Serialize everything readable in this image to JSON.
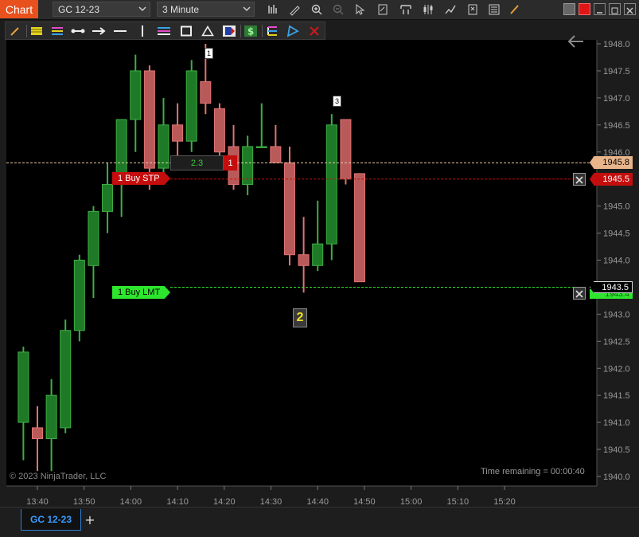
{
  "window": {
    "title": "Chart"
  },
  "toolbar": {
    "instrument": "GC 12-23",
    "interval": "3 Minute"
  },
  "icons": {
    "top": [
      "bar-chart-icon",
      "pencil-icon",
      "zoom-in-icon",
      "zoom-out-icon",
      "pointer-icon",
      "edit-doc-icon",
      "brackets-icon",
      "candlestick-icon",
      "line-chart-icon",
      "strategy-icon",
      "properties-icon",
      "draw-tool-icon"
    ],
    "draw": [
      "pencil-icon",
      "fib-icon",
      "layers-icon",
      "segment-icon",
      "arrow-line-icon",
      "horizontal-line-icon",
      "vertical-line-icon",
      "channel-icon",
      "rectangle-icon",
      "triangle-icon",
      "region-icon",
      "dollar-icon",
      "fib-ext-icon",
      "ruler-icon",
      "delete-draw-icon"
    ]
  },
  "chart": {
    "copyright": "© 2023 NinjaTrader, LLC",
    "time_remaining": "Time remaining = 00:00:40",
    "current_price_label": "1945.8",
    "buy_stp_price_label": "1945.5",
    "buy_lmt_price_label": "1943.5",
    "buy_lmt_under_label": "1943.4",
    "buy_stp_label": "1  Buy STP",
    "buy_lmt_label": "1  Buy LMT",
    "position_value": "2.3",
    "position_qty": "1",
    "marker_1": "1",
    "marker_2": "2",
    "marker_3": "3",
    "colors": {
      "up": "#1f7a28",
      "up_border": "#3fae45",
      "down": "#b85a5a",
      "down_border": "#e07474",
      "buy_stp": "#c40e0e",
      "buy_lmt": "#2ee62e",
      "current": "#e8b48a"
    }
  },
  "chart_data": {
    "type": "candlestick",
    "y_ticks": [
      "1948.0",
      "1947.5",
      "1947.0",
      "1946.5",
      "1946.0",
      "1945.5",
      "1945.0",
      "1944.5",
      "1944.0",
      "1943.5",
      "1943.0",
      "1942.5",
      "1942.0",
      "1941.5",
      "1941.0",
      "1940.5",
      "1940.0"
    ],
    "ylim": [
      1939.93,
      1948.1
    ],
    "x_ticks": [
      "13:40",
      "13:50",
      "14:00",
      "14:10",
      "14:20",
      "14:30",
      "14:40",
      "14:50",
      "15:00",
      "15:10",
      "15:20"
    ],
    "x_tick_minutes": [
      820,
      830,
      840,
      850,
      860,
      870,
      880,
      890,
      900,
      910,
      920
    ],
    "candles": [
      {
        "t": 817,
        "o": 1941.0,
        "h": 1942.4,
        "l": 1940.3,
        "c": 1942.3
      },
      {
        "t": 820,
        "o": 1940.9,
        "h": 1941.3,
        "l": 1940.1,
        "c": 1940.7
      },
      {
        "t": 823,
        "o": 1940.7,
        "h": 1941.8,
        "l": 1940.1,
        "c": 1941.5
      },
      {
        "t": 826,
        "o": 1940.9,
        "h": 1942.9,
        "l": 1940.8,
        "c": 1942.7
      },
      {
        "t": 829,
        "o": 1942.7,
        "h": 1944.1,
        "l": 1942.5,
        "c": 1944.0
      },
      {
        "t": 832,
        "o": 1943.9,
        "h": 1945.0,
        "l": 1943.3,
        "c": 1944.9
      },
      {
        "t": 835,
        "o": 1944.9,
        "h": 1945.8,
        "l": 1944.5,
        "c": 1945.4
      },
      {
        "t": 838,
        "o": 1945.4,
        "h": 1946.5,
        "l": 1944.8,
        "c": 1946.6
      },
      {
        "t": 841,
        "o": 1946.6,
        "h": 1947.8,
        "l": 1946.0,
        "c": 1947.5
      },
      {
        "t": 844,
        "o": 1947.5,
        "h": 1947.6,
        "l": 1945.3,
        "c": 1945.7
      },
      {
        "t": 847,
        "o": 1945.7,
        "h": 1947.0,
        "l": 1945.5,
        "c": 1946.5
      },
      {
        "t": 850,
        "o": 1946.5,
        "h": 1946.9,
        "l": 1945.9,
        "c": 1946.2
      },
      {
        "t": 853,
        "o": 1946.2,
        "h": 1947.7,
        "l": 1946.0,
        "c": 1947.5
      },
      {
        "t": 856,
        "o": 1947.3,
        "h": 1948.0,
        "l": 1946.7,
        "c": 1946.9
      },
      {
        "t": 859,
        "o": 1946.8,
        "h": 1946.9,
        "l": 1945.9,
        "c": 1946.0
      },
      {
        "t": 862,
        "o": 1946.1,
        "h": 1946.5,
        "l": 1945.3,
        "c": 1945.4
      },
      {
        "t": 865,
        "o": 1945.4,
        "h": 1946.3,
        "l": 1945.2,
        "c": 1946.1
      },
      {
        "t": 868,
        "o": 1946.1,
        "h": 1946.9,
        "l": 1946.1,
        "c": 1946.1
      },
      {
        "t": 871,
        "o": 1946.1,
        "h": 1946.5,
        "l": 1945.8,
        "c": 1945.8
      },
      {
        "t": 874,
        "o": 1945.8,
        "h": 1946.1,
        "l": 1943.9,
        "c": 1944.1
      },
      {
        "t": 877,
        "o": 1944.1,
        "h": 1944.8,
        "l": 1943.4,
        "c": 1943.9
      },
      {
        "t": 880,
        "o": 1943.9,
        "h": 1945.1,
        "l": 1943.8,
        "c": 1944.3
      },
      {
        "t": 883,
        "o": 1944.3,
        "h": 1946.7,
        "l": 1944.0,
        "c": 1946.5
      },
      {
        "t": 886,
        "o": 1946.6,
        "h": 1946.6,
        "l": 1945.4,
        "c": 1945.5
      },
      {
        "t": 889,
        "o": 1945.6,
        "h": 1945.6,
        "l": 1943.6,
        "c": 1943.6
      }
    ],
    "levels": {
      "current": 1945.8,
      "buy_stp": 1945.5,
      "buy_lmt": 1943.5
    }
  },
  "bottom": {
    "tab": "GC 12-23",
    "add": "+"
  }
}
